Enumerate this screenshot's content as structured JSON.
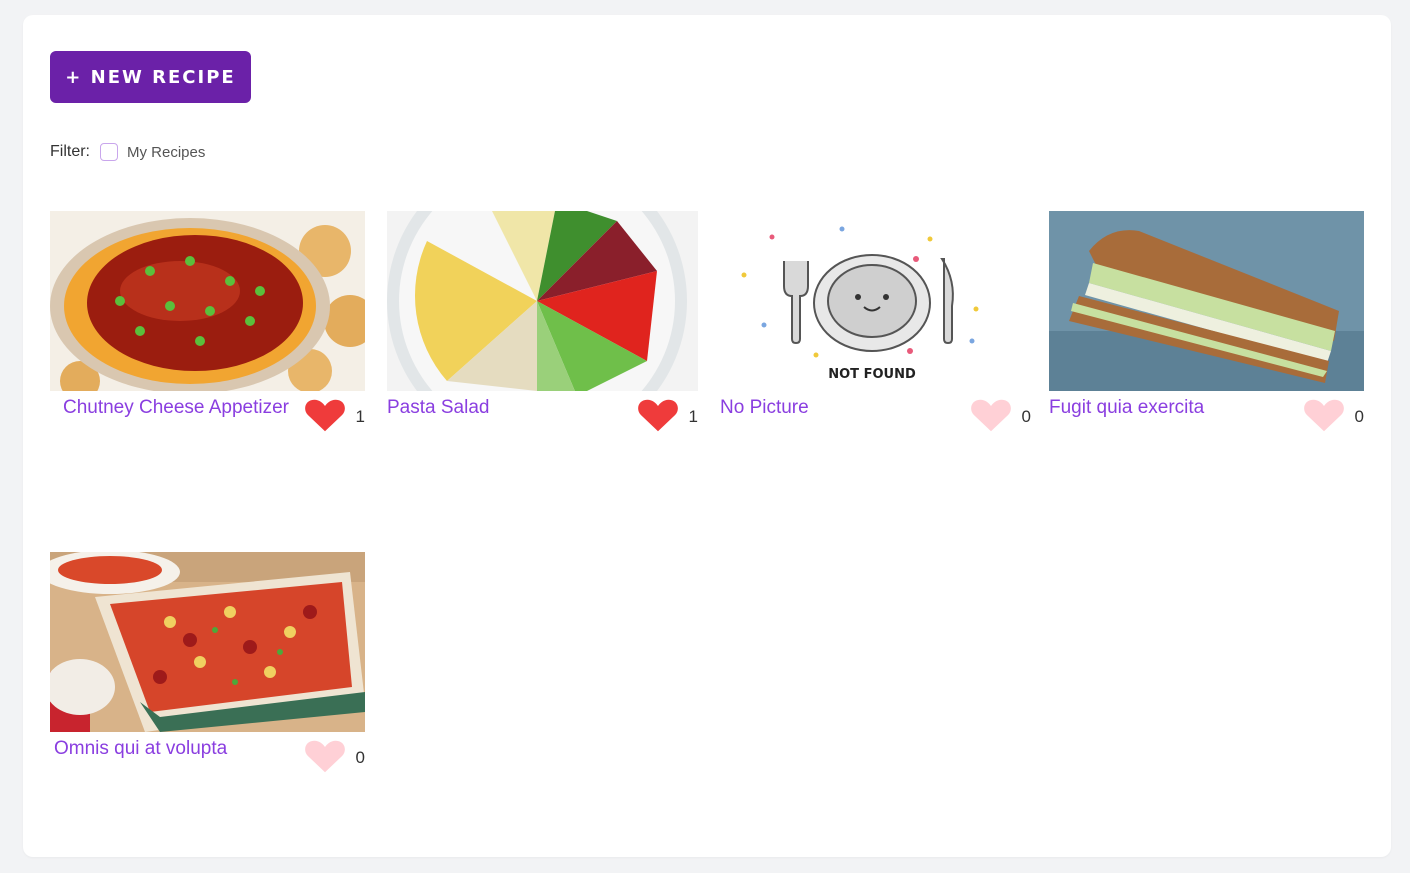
{
  "toolbar": {
    "new_recipe_label": "+ NEW RECIPE"
  },
  "filter": {
    "label": "Filter:",
    "my_recipes_label": "My Recipes"
  },
  "recipes": [
    {
      "title": "Chutney Cheese Appetizer",
      "likes": "1",
      "liked": true
    },
    {
      "title": "Pasta Salad",
      "likes": "1",
      "liked": true
    },
    {
      "title": "No Picture",
      "likes": "0",
      "liked": false,
      "image_caption": "NOT FOUND"
    },
    {
      "title": "Fugit quia exercita",
      "likes": "0",
      "liked": false
    },
    {
      "title": "Omnis qui at volupta",
      "likes": "0",
      "liked": false
    }
  ],
  "colors": {
    "accent": "#6b21a8",
    "title": "#8a3ee0",
    "heart_liked": "#ef3b3b",
    "heart_unliked": "#ffd0d6"
  }
}
